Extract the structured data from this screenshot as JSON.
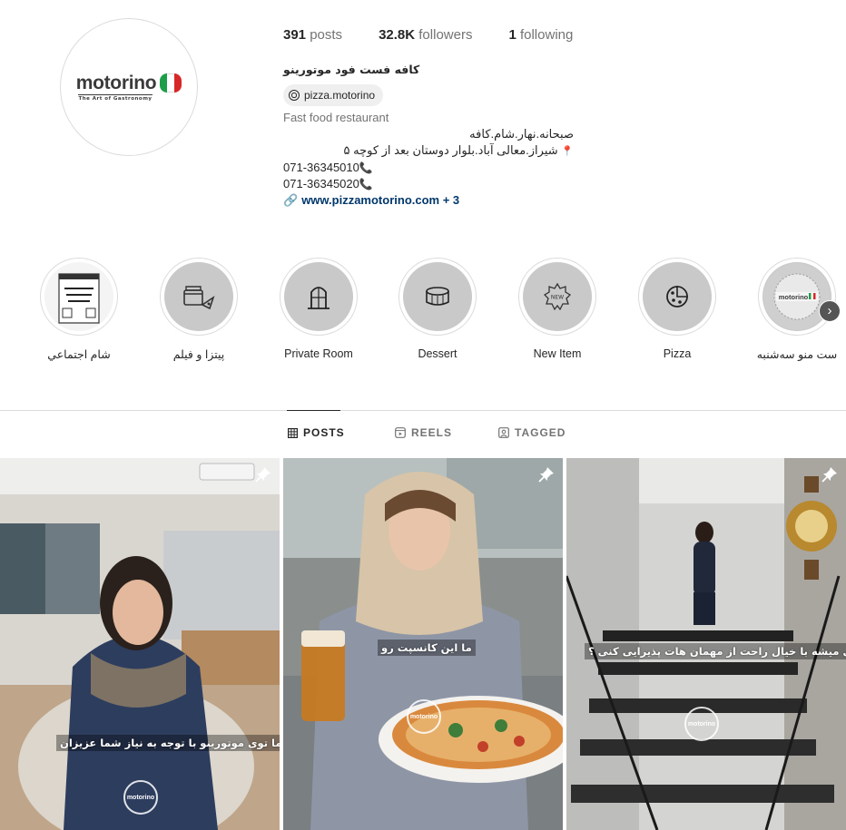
{
  "profile": {
    "logo": {
      "word": "motorino",
      "tagline": "The Art of Gastronomy",
      "flag_colors": [
        "#1e9e4a",
        "#ffffff",
        "#d62828"
      ]
    },
    "stats": {
      "posts_count": "391",
      "posts_label": "posts",
      "followers_count": "32.8K",
      "followers_label": "followers",
      "following_count": "1",
      "following_label": "following"
    },
    "full_name": "کافه فست فود موتورینو",
    "threads_handle": "pizza.motorino",
    "category": "Fast food restaurant",
    "bio_line1": "صبحانه.نهار.شام.کافه",
    "bio_address": "شیراز.معالی آباد.بلوار دوستان بعد از کوچه ۵",
    "phone1": "071-36345010",
    "phone2": "071-36345020",
    "link_text": "www.pizzamotorino.com + 3",
    "icons": {
      "pin": "pin-emoji-icon",
      "phone": "phone-emoji-icon",
      "link": "link-icon",
      "threads": "threads-icon"
    }
  },
  "highlights": [
    {
      "label": "شام اجتماعي",
      "icon": "poster-icon"
    },
    {
      "label": "پیتزا و فیلم",
      "icon": "film-pizza-icon"
    },
    {
      "label": "Private Room",
      "icon": "door-icon"
    },
    {
      "label": "Dessert",
      "icon": "cake-icon"
    },
    {
      "label": "New Item",
      "icon": "new-badge-icon"
    },
    {
      "label": "Pizza",
      "icon": "pizza-icon"
    },
    {
      "label": "ست منو سه‌شنبه",
      "icon": "motorino-logo-icon"
    }
  ],
  "tabs": [
    {
      "label": "POSTS",
      "icon": "grid-icon",
      "active": true
    },
    {
      "label": "REELS",
      "icon": "reels-icon",
      "active": false
    },
    {
      "label": "TAGGED",
      "icon": "tagged-icon",
      "active": false
    }
  ],
  "posts": [
    {
      "caption": "ما توی موتورینو با توجه به نیاز شما عزیزان",
      "pinned": true,
      "watermark": "motorino"
    },
    {
      "caption": "ما این کانسپت رو",
      "pinned": true,
      "watermark": "motorino"
    },
    {
      "caption": "چطوری میشه با خیال راحت از مهمان هات پذیرایی کنی ؟",
      "pinned": true,
      "watermark": "motorino"
    }
  ]
}
